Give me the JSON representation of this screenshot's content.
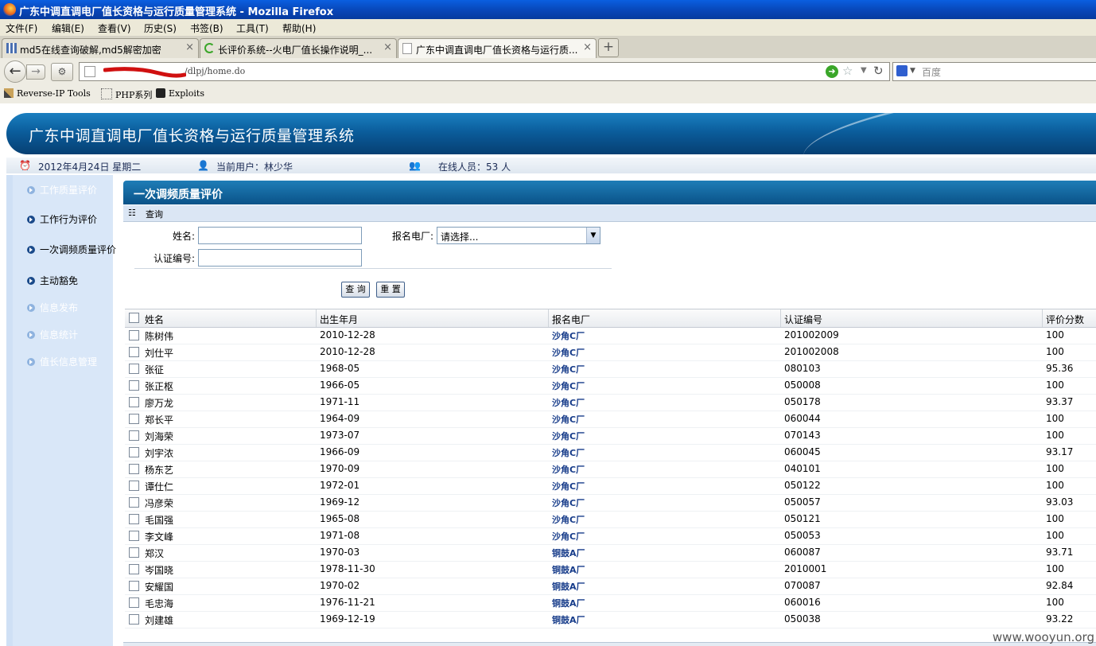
{
  "window": {
    "title": "广东中调直调电厂值长资格与运行质量管理系统 - Mozilla Firefox"
  },
  "menu": [
    "文件(F)",
    "编辑(E)",
    "查看(V)",
    "历史(S)",
    "书签(B)",
    "工具(T)",
    "帮助(H)"
  ],
  "tabs": [
    {
      "label": "md5在线查询破解,md5解密加密",
      "close": "×"
    },
    {
      "label": "长评价系统--火电厂值长操作说明_...",
      "close": "×"
    },
    {
      "label": "广东中调直调电厂值长资格与运行质...",
      "close": "×"
    }
  ],
  "newtab": "+",
  "url": "/dlpj/home.do",
  "search_placeholder": "百度",
  "bookmarks": [
    "Reverse-IP Tools",
    "PHP系列",
    "Exploits"
  ],
  "banner": {
    "title": "广东中调直调电厂值长资格与运行质量管理系统"
  },
  "status": {
    "date": "2012年4月24日 星期二",
    "user": "当前用户：林少华",
    "online": "在线人员：53 人"
  },
  "sidebar": [
    {
      "label": "工作质量评价",
      "faded": true
    },
    {
      "label": "工作行为评价",
      "faded": false
    },
    {
      "label": "一次调频质量评价",
      "faded": false
    },
    {
      "label": "主动豁免",
      "faded": false
    },
    {
      "label": "信息发布",
      "faded": true
    },
    {
      "label": "信息统计",
      "faded": true
    },
    {
      "label": "值长信息管理",
      "faded": true
    }
  ],
  "panel": {
    "title": "一次调频质量评价",
    "query_title": "查询"
  },
  "form": {
    "name_label": "姓名:",
    "plant_label": "报名电厂:",
    "plant_value": "请选择...",
    "cert_label": "认证编号:",
    "query_btn": "查 询",
    "reset_btn": "重 置"
  },
  "table": {
    "headers": [
      "姓名",
      "出生年月",
      "报名电厂",
      "认证编号",
      "评价分数"
    ],
    "rows": [
      [
        "陈树伟",
        "2010-12-28",
        "沙角C厂",
        "201002009",
        "100"
      ],
      [
        "刘仕平",
        "2010-12-28",
        "沙角C厂",
        "201002008",
        "100"
      ],
      [
        "张征",
        "1968-05",
        "沙角C厂",
        "080103",
        "95.36"
      ],
      [
        "张正枢",
        "1966-05",
        "沙角C厂",
        "050008",
        "100"
      ],
      [
        "廖万龙",
        "1971-11",
        "沙角C厂",
        "050178",
        "93.37"
      ],
      [
        "郑长平",
        "1964-09",
        "沙角C厂",
        "060044",
        "100"
      ],
      [
        "刘海荣",
        "1973-07",
        "沙角C厂",
        "070143",
        "100"
      ],
      [
        "刘宇浓",
        "1966-09",
        "沙角C厂",
        "060045",
        "93.17"
      ],
      [
        "杨东艺",
        "1970-09",
        "沙角C厂",
        "040101",
        "100"
      ],
      [
        "谭仕仁",
        "1972-01",
        "沙角C厂",
        "050122",
        "100"
      ],
      [
        "冯彦荣",
        "1969-12",
        "沙角C厂",
        "050057",
        "93.03"
      ],
      [
        "毛国强",
        "1965-08",
        "沙角C厂",
        "050121",
        "100"
      ],
      [
        "李文峰",
        "1971-08",
        "沙角C厂",
        "050053",
        "100"
      ],
      [
        "郑汉",
        "1970-03",
        "铜鼓A厂",
        "060087",
        "93.71"
      ],
      [
        "岑国晓",
        "1978-11-30",
        "铜鼓A厂",
        "2010001",
        "100"
      ],
      [
        "安耀国",
        "1970-02",
        "铜鼓A厂",
        "070087",
        "92.84"
      ],
      [
        "毛忠海",
        "1976-11-21",
        "铜鼓A厂",
        "060016",
        "100"
      ],
      [
        "刘建雄",
        "1969-12-19",
        "铜鼓A厂",
        "050038",
        "93.22"
      ]
    ]
  },
  "watermark": "www.wooyun.org",
  "colors": {
    "title_bar": "#0846b8",
    "banner": "#0b5d9c",
    "panel_header": "#0a5288",
    "plant_text": "#173c8a",
    "sidebar": "#d9e7f8"
  }
}
